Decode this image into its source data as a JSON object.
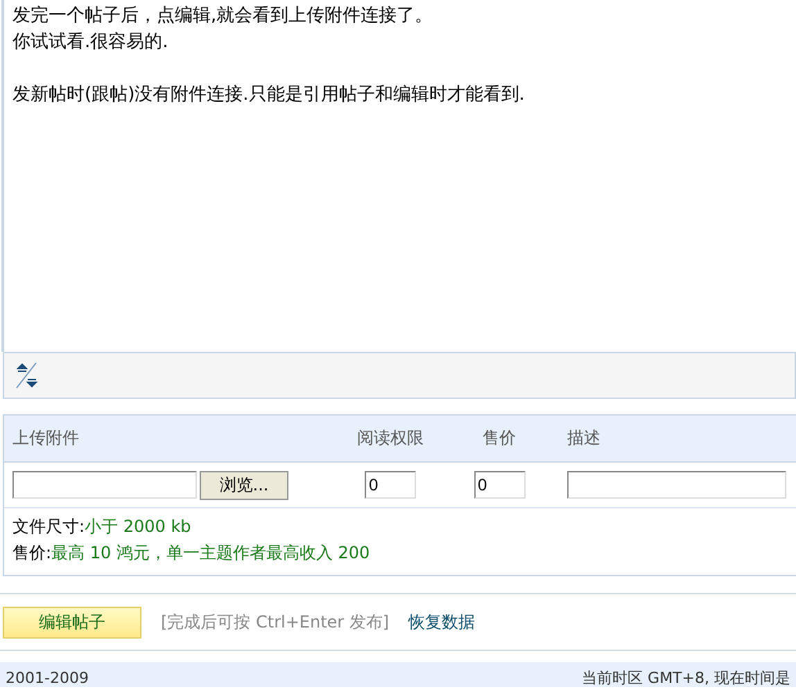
{
  "editor": {
    "paragraphs": [
      [
        "发完一个帖子后，点编辑,就会看到上传附件连接了。",
        "你试试看.很容易的."
      ],
      [
        "发新帖时(跟帖)没有附件连接.只能是引用帖子和编辑时才能看到."
      ]
    ]
  },
  "attachments": {
    "columns": [
      "上传附件",
      "阅读权限",
      "售价",
      "描述"
    ],
    "browse_button": "浏览...",
    "permission_value": "0",
    "price_value": "0",
    "info": [
      {
        "label": "文件尺寸:",
        "value": "小于  2000 kb"
      },
      {
        "label": "售价:",
        "value": "最高  10 鸿元，单一主题作者最高收入  200"
      }
    ]
  },
  "actions": {
    "submit_button": "编辑帖子",
    "hint": "[完成后可按  Ctrl+Enter 发布]",
    "restore_link": "恢复数据"
  },
  "footer": {
    "left": "2001-2009",
    "right": "当前时区  GMT+8, 现在时间是"
  }
}
